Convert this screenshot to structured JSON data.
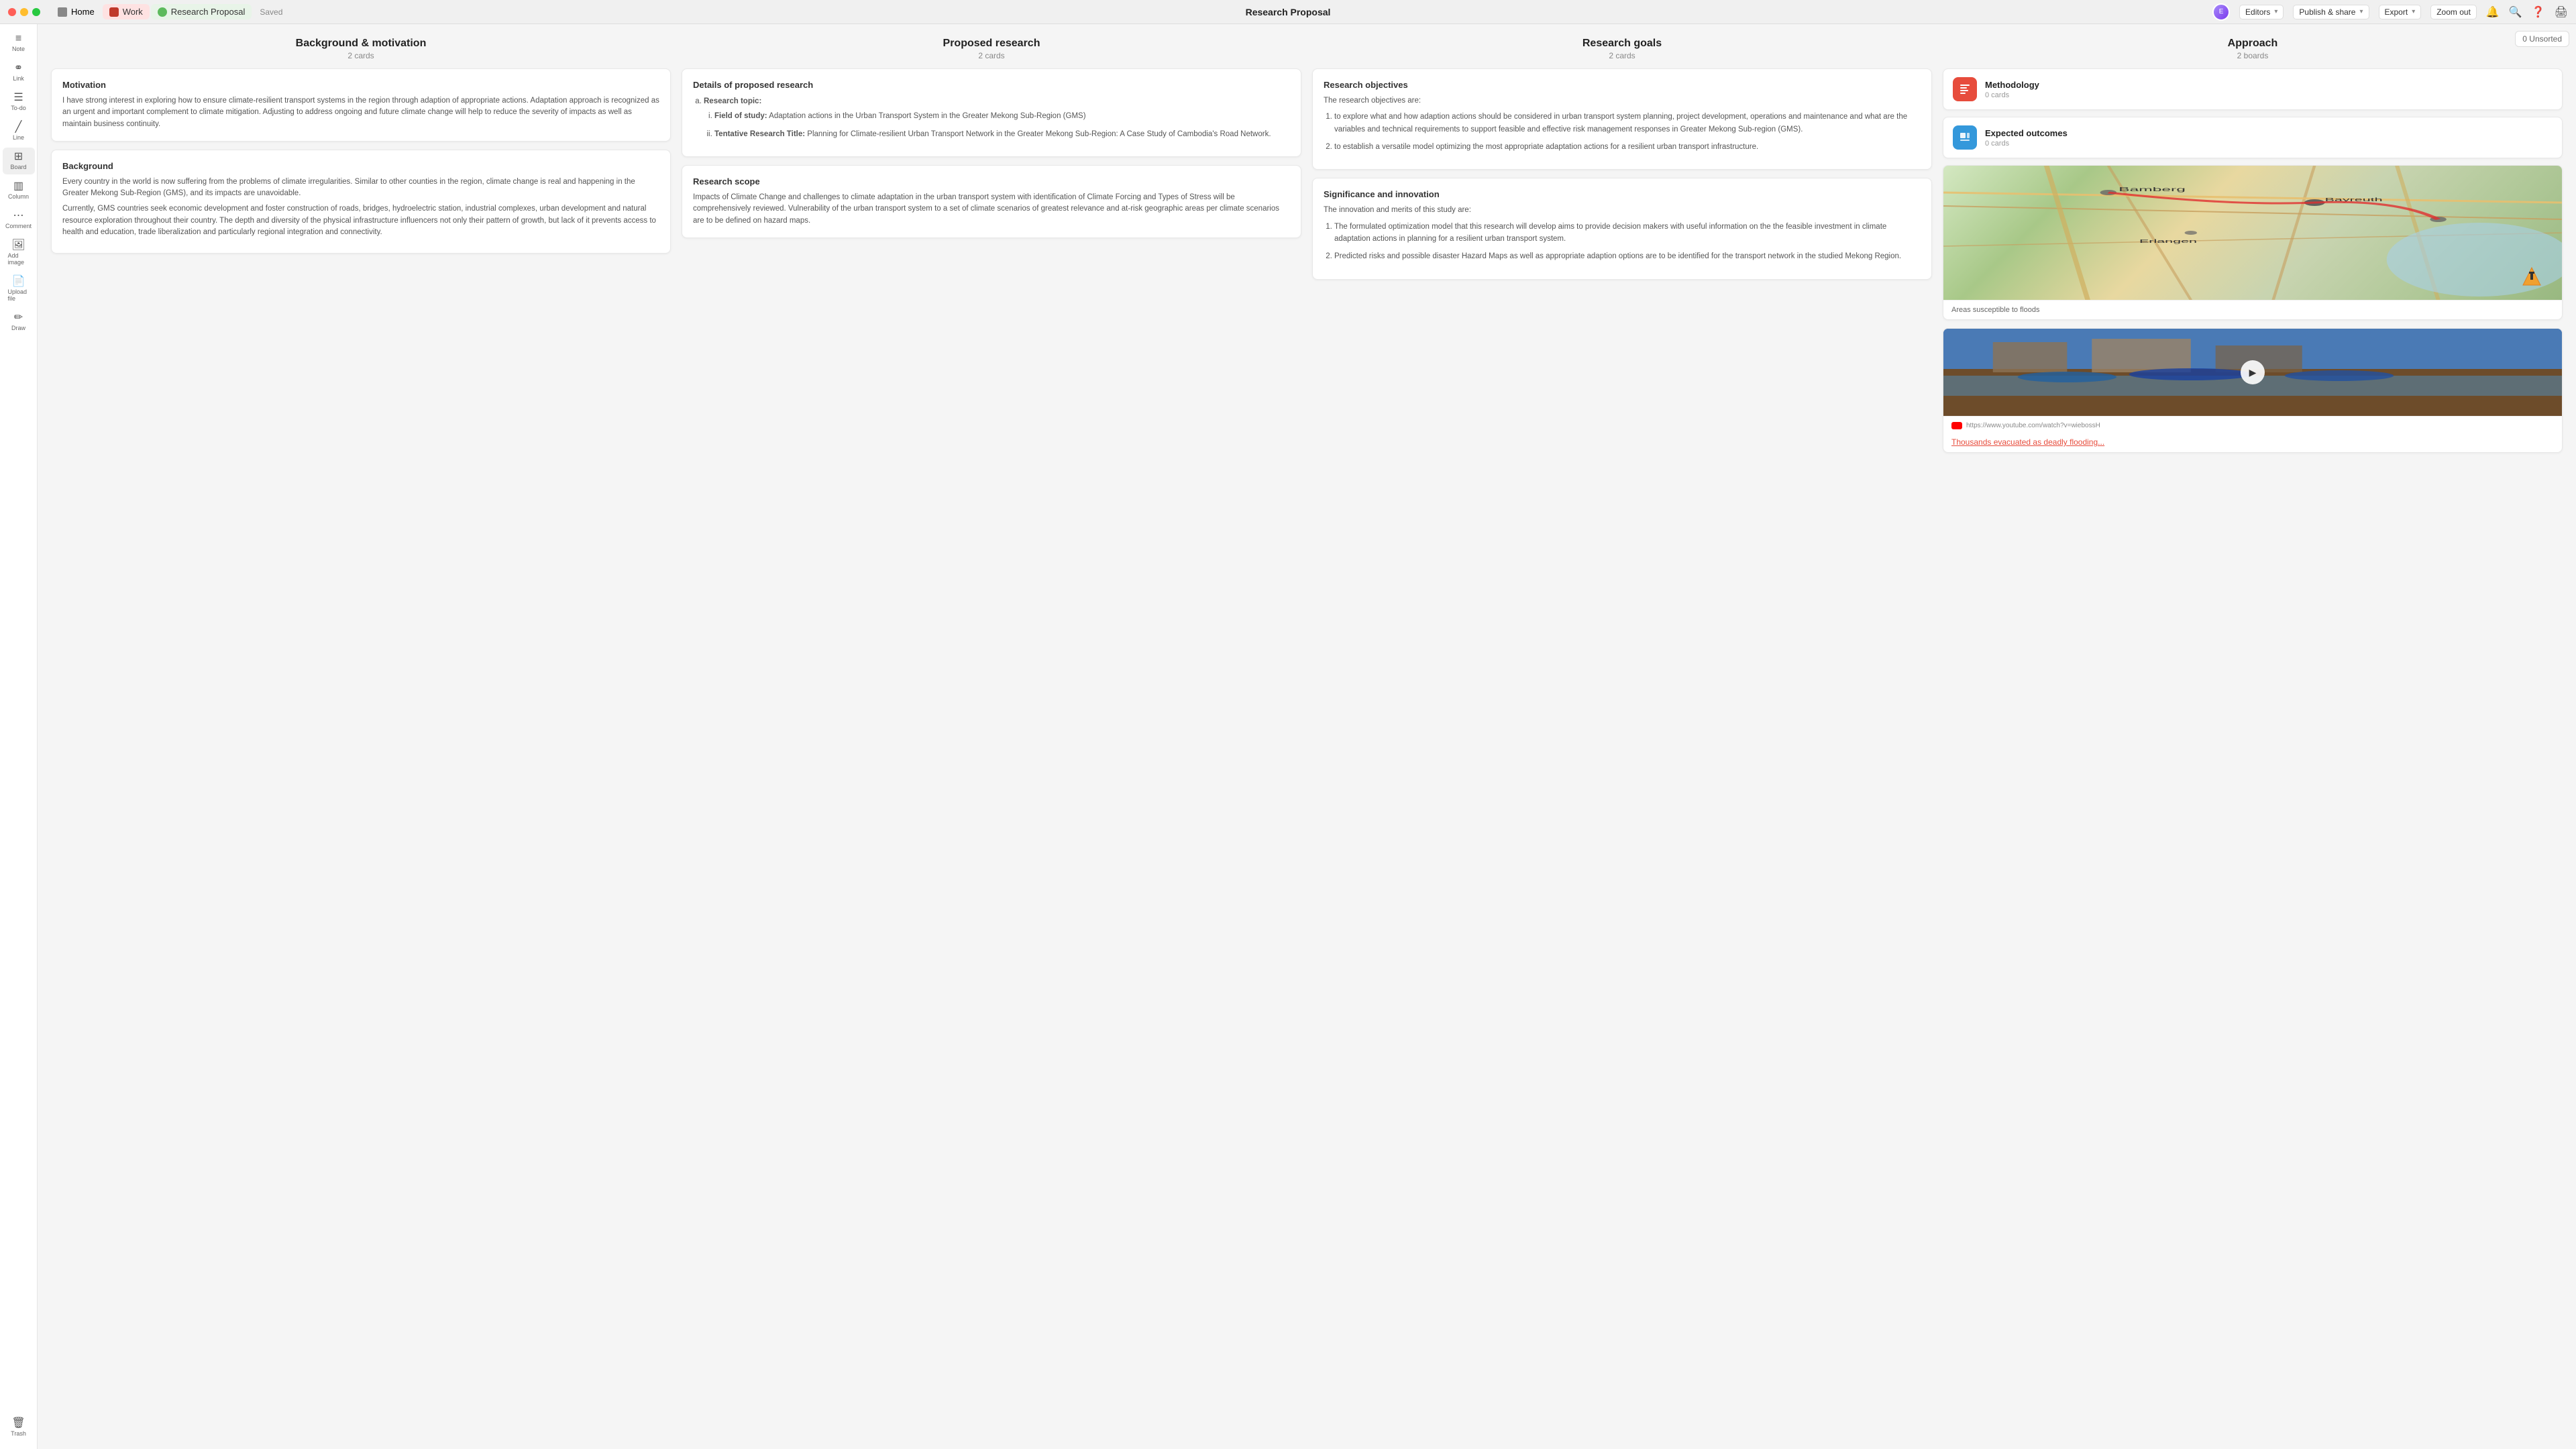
{
  "titlebar": {
    "tabs": [
      {
        "id": "home",
        "label": "Home",
        "icon": "home"
      },
      {
        "id": "work",
        "label": "Work",
        "icon": "work"
      },
      {
        "id": "rp",
        "label": "Research Proposal",
        "icon": "rp",
        "active": true
      }
    ],
    "title": "Research Proposal",
    "saved": "Saved",
    "editors": "Editors",
    "publish": "Publish & share",
    "export": "Export",
    "zoom": "Zoom out"
  },
  "sidebar": {
    "items": [
      {
        "id": "note",
        "icon": "≡",
        "label": "Note"
      },
      {
        "id": "link",
        "icon": "🔗",
        "label": "Link"
      },
      {
        "id": "todo",
        "icon": "☰",
        "label": "To-do"
      },
      {
        "id": "line",
        "icon": "/",
        "label": "Line"
      },
      {
        "id": "board",
        "icon": "⊞",
        "label": "Board",
        "active": true
      },
      {
        "id": "column",
        "icon": "▥",
        "label": "Column"
      },
      {
        "id": "comment",
        "icon": "💬",
        "label": "Comment"
      },
      {
        "id": "addimage",
        "icon": "🖼",
        "label": "Add image"
      },
      {
        "id": "uploadfile",
        "icon": "📄",
        "label": "Upload file"
      },
      {
        "id": "draw",
        "icon": "✏",
        "label": "Draw"
      }
    ],
    "trash": "Trash"
  },
  "canvas": {
    "unsorted_label": "0 Unsorted",
    "columns": [
      {
        "id": "background",
        "title": "Background & motivation",
        "subtitle": "2 cards",
        "cards": [
          {
            "id": "motivation",
            "title": "Motivation",
            "body": "I have strong interest in exploring how to ensure climate-resilient transport systems in the region through adaption of appropriate actions. Adaptation approach is recognized as an urgent and important complement to climate mitigation. Adjusting to address ongoing and future climate change will help to reduce the severity of impacts as well as maintain business continuity."
          },
          {
            "id": "background",
            "title": "Background",
            "body1": "Every country in the world is now suffering from the problems of climate irregularities. Similar to other counties in the region, climate change is real and happening in the Greater Mekong Sub-Region (GMS), and its impacts are unavoidable.",
            "body2": "Currently, GMS countries seek economic development and foster construction of roads, bridges, hydroelectric station, industrial complexes, urban development and natural resource exploration throughout their country. The depth and diversity of the physical infrastructure influencers not only their pattern of growth, but lack of it prevents access to health and education, trade liberalization and particularly regional integration and connectivity."
          }
        ]
      },
      {
        "id": "proposed",
        "title": "Proposed research",
        "subtitle": "2 cards",
        "cards": [
          {
            "id": "details",
            "title": "Details of proposed research",
            "topic_label": "Research topic:",
            "field_label": "Field of study:",
            "field_text": "Adaptation actions in the Urban Transport System in the Greater Mekong Sub-Region (GMS)",
            "title_label": "Tentative Research Title:",
            "title_text": "Planning for Climate-resilient Urban Transport Network in the Greater Mekong Sub-Region: A Case Study of Cambodia's Road Network."
          },
          {
            "id": "scope",
            "title": "Research scope",
            "body": "Impacts of Climate Change and challenges to climate adaptation in the urban transport system with identification of Climate Forcing and Types of Stress will be comprehensively reviewed. Vulnerability of the urban transport system to a set of climate scenarios of greatest relevance and at-risk geographic areas per climate scenarios are to be defined on hazard maps."
          }
        ]
      },
      {
        "id": "goals",
        "title": "Research goals",
        "subtitle": "2 cards",
        "cards": [
          {
            "id": "objectives",
            "title": "Research objectives",
            "intro": "The research objectives are:",
            "items": [
              "to explore what and how adaption actions should be considered in urban transport system planning, project development, operations and maintenance and what are the variables and technical requirements to support feasible and effective risk management responses in Greater Mekong Sub-region (GMS).",
              "to establish a versatile model optimizing the most appropriate adaptation actions for a resilient urban transport infrastructure."
            ]
          },
          {
            "id": "significance",
            "title": "Significance and innovation",
            "intro": "The innovation and merits of this study are:",
            "items": [
              "The formulated optimization model that this research will develop aims to provide decision makers with useful information on the the feasible investment in climate adaptation actions in planning for a resilient urban transport system.",
              "Predicted risks and possible disaster Hazard Maps as well as appropriate adaption options are to be identified for the transport network in the studied Mekong Region."
            ]
          }
        ]
      },
      {
        "id": "approach",
        "title": "Approach",
        "subtitle": "2 boards",
        "boards": [
          {
            "id": "methodology",
            "icon": "methodology",
            "title": "Methodology",
            "subtitle": "0 cards"
          },
          {
            "id": "expected",
            "icon": "expected",
            "title": "Expected outcomes",
            "subtitle": "0 cards"
          }
        ],
        "media": [
          {
            "id": "map",
            "caption": "Areas susceptible to floods"
          },
          {
            "id": "video",
            "url": "https://www.youtube.com/watch?v=wiebossH",
            "title": "Thousands evacuated as deadly flooding..."
          }
        ]
      }
    ]
  }
}
